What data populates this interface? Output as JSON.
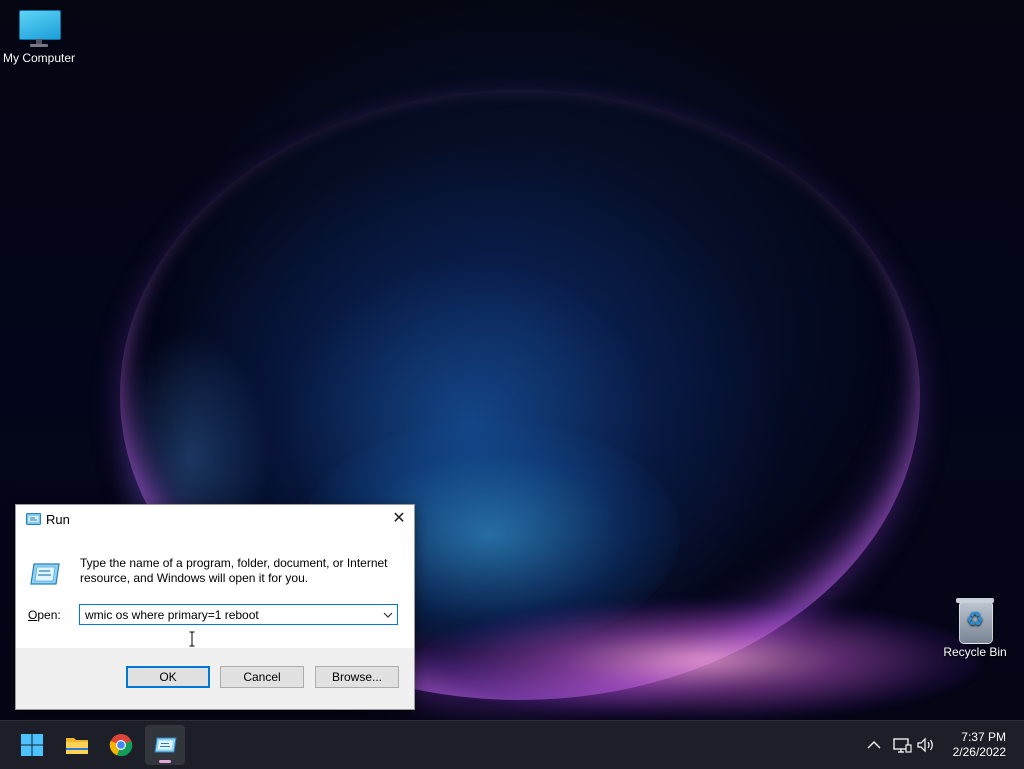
{
  "desktop": {
    "icons": [
      {
        "label": "My Computer",
        "icon": "computer-icon"
      },
      {
        "label": "Recycle Bin",
        "icon": "recycle-bin-icon"
      }
    ]
  },
  "run_dialog": {
    "title": "Run",
    "close_glyph": "✕",
    "description": "Type the name of a program, folder, document, or Internet resource, and Windows will open it for you.",
    "open_label_accel": "O",
    "open_label_rest": "pen:",
    "command_value": "wmic os where primary=1 reboot",
    "buttons": {
      "ok": "OK",
      "cancel": "Cancel",
      "browse": "Browse..."
    },
    "focus_color": "#0078d7"
  },
  "taskbar": {
    "items": [
      {
        "name": "start",
        "icon": "windows-start-icon"
      },
      {
        "name": "file-explorer",
        "icon": "folder-icon"
      },
      {
        "name": "chrome",
        "icon": "chrome-icon"
      },
      {
        "name": "run",
        "icon": "run-icon",
        "active": true
      }
    ],
    "tray": {
      "chevron": "^",
      "time": "7:37 PM",
      "date": "2/26/2022"
    }
  }
}
